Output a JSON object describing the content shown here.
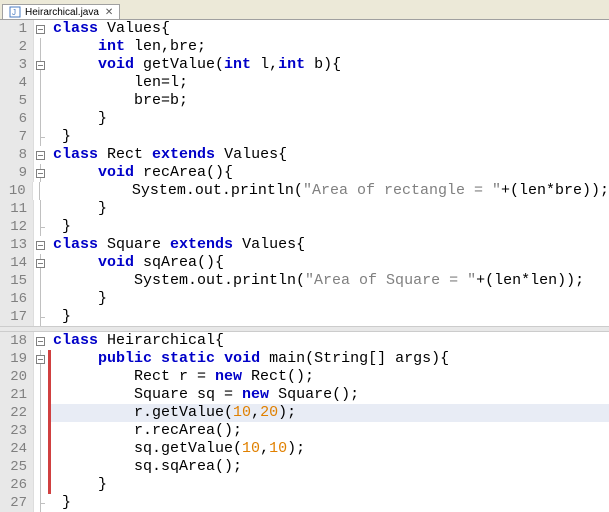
{
  "tab": {
    "label": "Heirarchical.java"
  },
  "kw": {
    "class": "class",
    "int": "int",
    "void": "void",
    "extends": "extends",
    "public": "public",
    "static": "static",
    "new": "new"
  },
  "code": {
    "l1": {
      "a": "Values{"
    },
    "l2": {
      "a": " len,bre;"
    },
    "l3": {
      "a": " getValue(",
      "b": " l,",
      "c": " b){"
    },
    "l4": {
      "a": "len=l;"
    },
    "l5": {
      "a": "bre=b;"
    },
    "l6": {
      "a": "}"
    },
    "l7": {
      "a": "}"
    },
    "l8": {
      "a": "Rect ",
      "b": " Values{"
    },
    "l9": {
      "a": " recArea(){"
    },
    "l10": {
      "a": "System.out.println(",
      "s": "\"Area of rectangle = \"",
      "b": "+(len*bre));"
    },
    "l11": {
      "a": "}"
    },
    "l12": {
      "a": "}"
    },
    "l13": {
      "a": "Square ",
      "b": " Values{"
    },
    "l14": {
      "a": " sqArea(){"
    },
    "l15": {
      "a": "System.out.println(",
      "s": "\"Area of Square = \"",
      "b": "+(len*len));"
    },
    "l16": {
      "a": "}"
    },
    "l17": {
      "a": "}"
    },
    "l18": {
      "a": "Heirarchical{"
    },
    "l19": {
      "a": " main(String[] args){"
    },
    "l20": {
      "a": "Rect r = ",
      "b": " Rect();"
    },
    "l21": {
      "a": "Square sq = ",
      "b": " Square();"
    },
    "l22": {
      "a": "r.getValue(",
      "n1": "10",
      "c": ",",
      "n2": "20",
      "b": ");"
    },
    "l23": {
      "a": "r.recArea();"
    },
    "l24": {
      "a": "sq.getValue(",
      "n1": "10",
      "c": ",",
      "n2": "10",
      "b": ");"
    },
    "l25": {
      "a": "sq.sqArea();"
    },
    "l26": {
      "a": "}"
    },
    "l27": {
      "a": "}"
    }
  },
  "ln": {
    "1": "1",
    "2": "2",
    "3": "3",
    "4": "4",
    "5": "5",
    "6": "6",
    "7": "7",
    "8": "8",
    "9": "9",
    "10": "10",
    "11": "11",
    "12": "12",
    "13": "13",
    "14": "14",
    "15": "15",
    "16": "16",
    "17": "17",
    "18": "18",
    "19": "19",
    "20": "20",
    "21": "21",
    "22": "22",
    "23": "23",
    "24": "24",
    "25": "25",
    "26": "26",
    "27": "27"
  }
}
